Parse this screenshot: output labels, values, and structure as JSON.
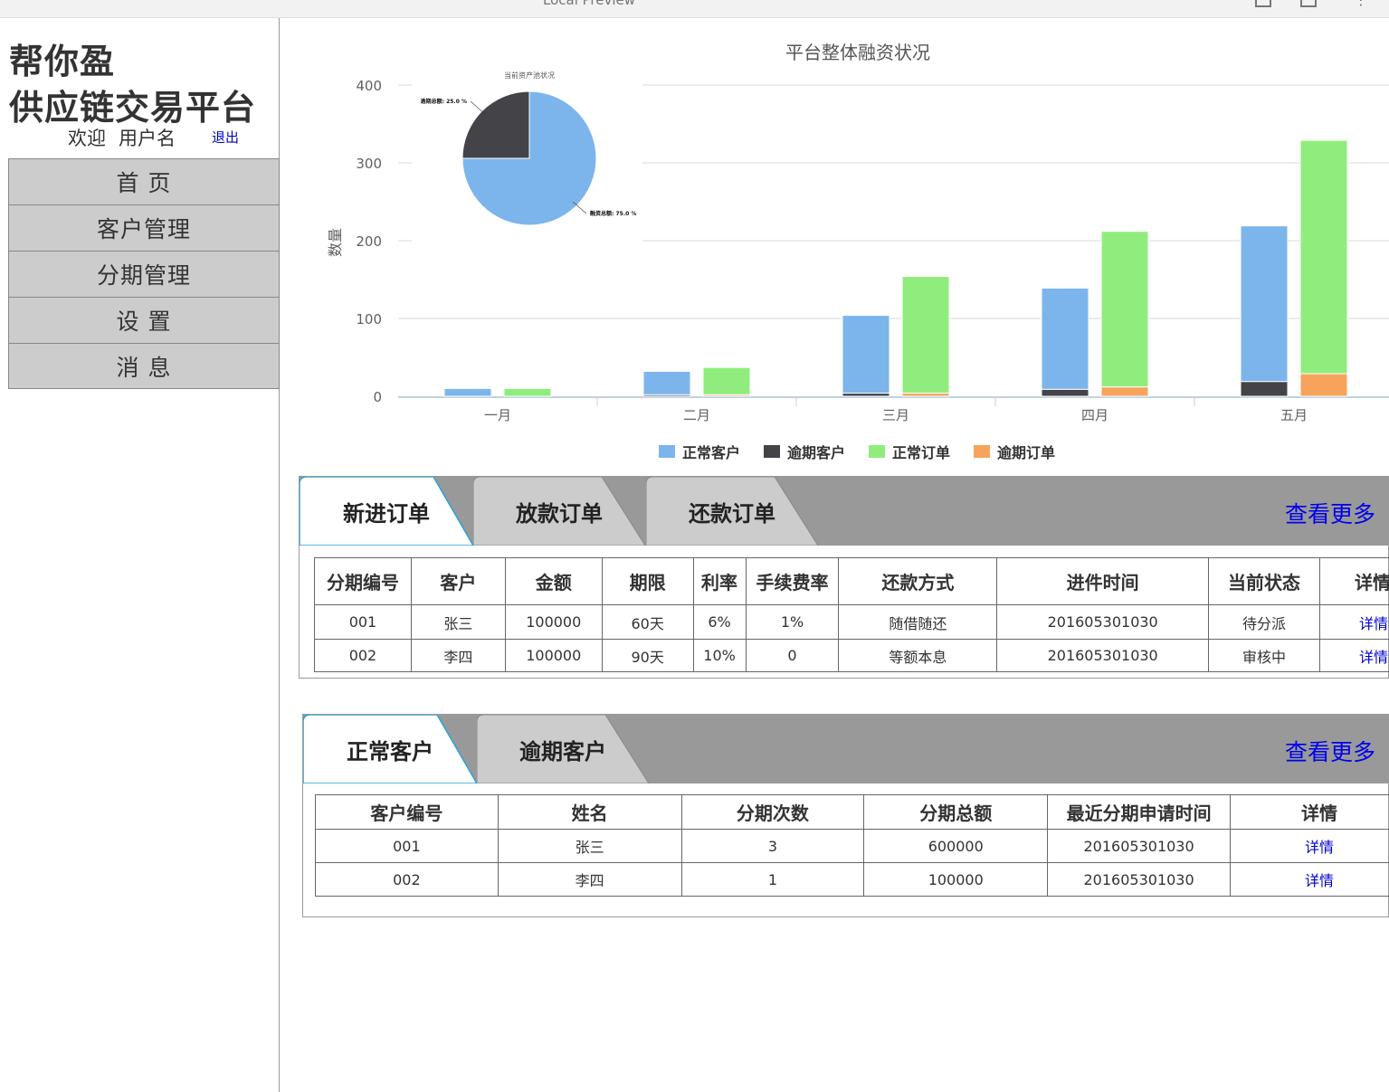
{
  "window": {
    "title": "Local Preview"
  },
  "brand": {
    "line1": "帮你盈",
    "line2": "供应链交易平台"
  },
  "user": {
    "welcome": "欢迎",
    "username": "用户名",
    "logout": "退出"
  },
  "nav": {
    "items": [
      "首 页",
      "客户管理",
      "分期管理",
      "设 置",
      "消 息"
    ]
  },
  "colors": {
    "normal_customer": "#7cb5ec",
    "overdue_customer": "#434348",
    "normal_order": "#90ed7d",
    "overdue_order": "#f7a35c",
    "link": "#0000ee",
    "tab_bg": "#999999",
    "tab_inactive": "#cccccc"
  },
  "chart_data": [
    {
      "type": "bar",
      "title": "平台整体融资状况",
      "ylabel": "数量",
      "ylim": [
        0,
        400
      ],
      "yticks": [
        0,
        100,
        200,
        300,
        400
      ],
      "categories": [
        "一月",
        "二月",
        "三月",
        "四月",
        "五月"
      ],
      "stack_groups": [
        [
          "正常客户",
          "逾期客户"
        ],
        [
          "正常订单",
          "逾期订单"
        ]
      ],
      "series": [
        {
          "name": "正常客户",
          "values": [
            10,
            30,
            100,
            130,
            200
          ],
          "color": "#7cb5ec"
        },
        {
          "name": "逾期客户",
          "values": [
            0,
            2,
            4,
            9,
            19
          ],
          "color": "#434348"
        },
        {
          "name": "正常订单",
          "values": [
            10,
            35,
            150,
            200,
            300
          ],
          "color": "#90ed7d"
        },
        {
          "name": "逾期订单",
          "values": [
            0,
            2,
            4,
            12,
            29
          ],
          "color": "#f7a35c"
        }
      ],
      "legend_position": "bottom"
    },
    {
      "type": "pie",
      "title": "当前资产池状况",
      "slices": [
        {
          "label": "融资总额",
          "value": 75.0,
          "display": "融资总额: 75.0 %",
          "color": "#7cb5ec"
        },
        {
          "label": "逾期总额",
          "value": 25.0,
          "display": "逾期总额: 25.0 %",
          "color": "#434348"
        }
      ]
    }
  ],
  "orders_panel": {
    "tabs": [
      "新进订单",
      "放款订单",
      "还款订单"
    ],
    "more": "查看更多",
    "headers": [
      "分期编号",
      "客户",
      "金额",
      "期限",
      "利率",
      "手续费率",
      "还款方式",
      "进件时间",
      "当前状态",
      "详情"
    ],
    "rows": [
      [
        "001",
        "张三",
        "100000",
        "60天",
        "6%",
        "1%",
        "随借随还",
        "201605301030",
        "待分派",
        "详情"
      ],
      [
        "002",
        "李四",
        "100000",
        "90天",
        "10%",
        "0",
        "等额本息",
        "201605301030",
        "审核中",
        "详情"
      ]
    ]
  },
  "customers_panel": {
    "tabs": [
      "正常客户",
      "逾期客户"
    ],
    "more": "查看更多",
    "headers": [
      "客户编号",
      "姓名",
      "分期次数",
      "分期总额",
      "最近分期申请时间",
      "详情"
    ],
    "rows": [
      [
        "001",
        "张三",
        "3",
        "600000",
        "201605301030",
        "详情"
      ],
      [
        "002",
        "李四",
        "1",
        "100000",
        "201605301030",
        "详情"
      ]
    ]
  }
}
